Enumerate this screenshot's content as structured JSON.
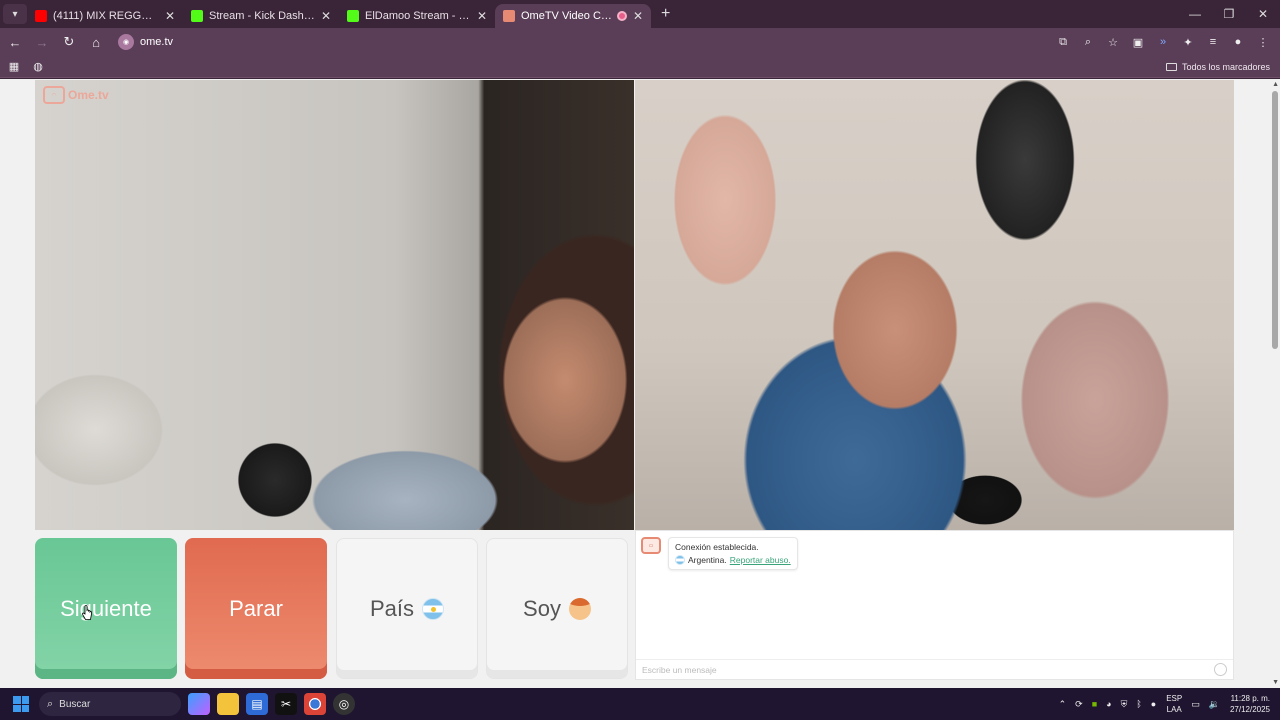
{
  "browser": {
    "tabs": [
      {
        "title": "(4111) MIX REGGAETON 2025 |",
        "icon_color": "#ff0000",
        "active": false
      },
      {
        "title": "Stream - Kick Dashboard",
        "icon_color": "#53fc18",
        "active": false
      },
      {
        "title": "ElDamoo Stream - Watch Live o",
        "icon_color": "#53fc18",
        "active": false
      },
      {
        "title": "OmeTV Video Chat — Ome",
        "icon_color": "#e68a74",
        "active": true
      }
    ],
    "address": "ome.tv",
    "bookmarks_all": "Todos los marcadores"
  },
  "page": {
    "logo_text": "Ome.tv",
    "buttons": {
      "next": "Siguiente",
      "stop": "Parar",
      "country": "País",
      "gender": "Soy"
    },
    "chat": {
      "status_line": "Conexión establecida.",
      "country_line": "Argentina.",
      "report_link": "Reportar abuso.",
      "input_placeholder": "Escribe un mensaje"
    }
  },
  "taskbar": {
    "search_label": "Buscar",
    "lang_top": "ESP",
    "lang_bottom": "LAA",
    "time": "11:28 p. m.",
    "date": "27/12/2025"
  }
}
